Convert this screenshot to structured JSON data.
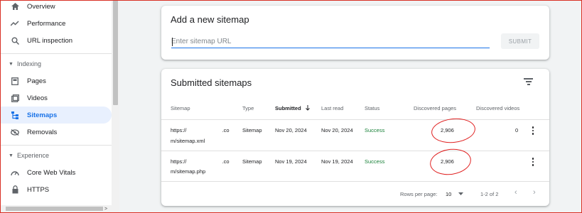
{
  "sidebar": {
    "items": [
      {
        "label": "Overview",
        "icon": "home-icon"
      },
      {
        "label": "Performance",
        "icon": "trend-icon"
      },
      {
        "label": "URL inspection",
        "icon": "search-icon"
      }
    ],
    "indexing_header": "Indexing",
    "indexing_items": [
      {
        "label": "Pages",
        "icon": "pages-icon"
      },
      {
        "label": "Videos",
        "icon": "video-icon"
      },
      {
        "label": "Sitemaps",
        "icon": "sitemap-icon",
        "active": true
      },
      {
        "label": "Removals",
        "icon": "removals-icon"
      }
    ],
    "experience_header": "Experience",
    "experience_items": [
      {
        "label": "Core Web Vitals",
        "icon": "gauge-icon"
      },
      {
        "label": "HTTPS",
        "icon": "lock-icon"
      }
    ]
  },
  "add_sitemap": {
    "title": "Add a new sitemap",
    "placeholder": "Enter sitemap URL",
    "submit_label": "SUBMIT"
  },
  "submitted": {
    "title": "Submitted sitemaps",
    "columns": {
      "sitemap": "Sitemap",
      "type": "Type",
      "submitted": "Submitted",
      "last_read": "Last read",
      "status": "Status",
      "discovered_pages": "Discovered pages",
      "discovered_videos": "Discovered videos"
    },
    "rows": [
      {
        "sitemap_line1_start": "https://",
        "sitemap_line1_end": ".co",
        "sitemap_line2": "m/sitemap.xml",
        "type": "Sitemap",
        "submitted": "Nov 20, 2024",
        "last_read": "Nov 20, 2024",
        "status": "Success",
        "discovered_pages": "2,906",
        "discovered_videos": "0"
      },
      {
        "sitemap_line1_start": "https://",
        "sitemap_line1_end": ".co",
        "sitemap_line2": "m/sitemap.php",
        "type": "Sitemap",
        "submitted": "Nov 19, 2024",
        "last_read": "Nov 19, 2024",
        "status": "Success",
        "discovered_pages": "2,906",
        "discovered_videos": ""
      }
    ],
    "footer": {
      "rows_per_page_label": "Rows per page:",
      "rows_per_page_value": "10",
      "range": "1-2 of 2"
    }
  },
  "colors": {
    "accent": "#1a73e8",
    "success": "#188038",
    "annotation": "#e02020"
  }
}
